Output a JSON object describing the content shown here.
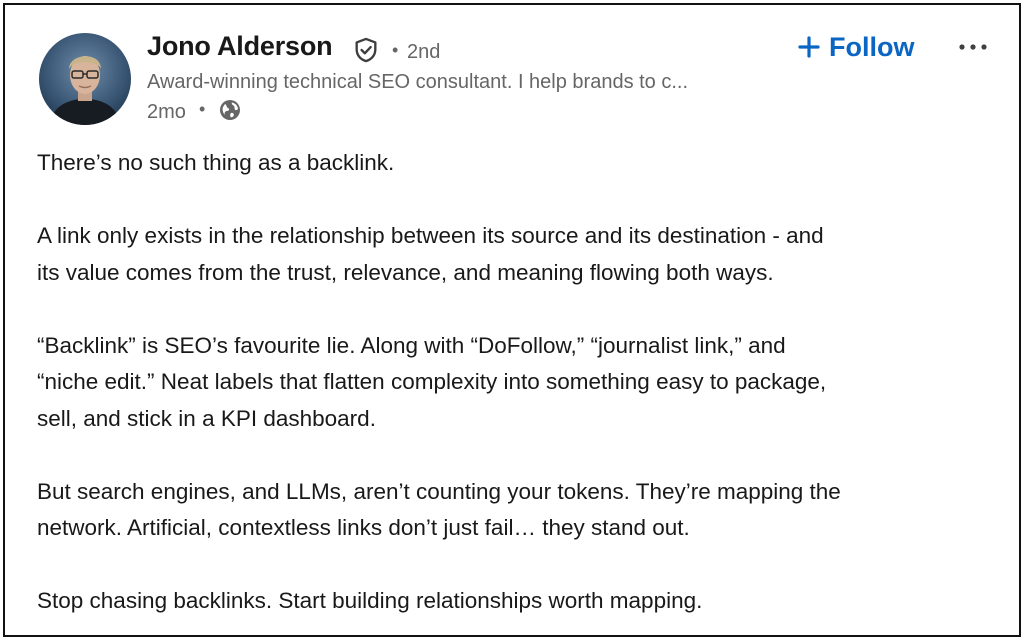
{
  "author": {
    "name": "Jono Alderson",
    "verified_icon": "verified-shield-icon",
    "degree": "2nd",
    "headline": "Award-winning technical SEO consultant. I help brands to c...",
    "timestamp": "2mo",
    "visibility_icon": "globe-icon"
  },
  "actions": {
    "follow_label": "Follow",
    "follow_icon": "plus-icon",
    "more_icon": "more-options-icon"
  },
  "colors": {
    "accent": "#0a66c2",
    "text_primary": "#191919",
    "text_secondary": "#666666"
  },
  "post": {
    "paragraphs": [
      {
        "lines": [
          "There’s no such thing as a backlink."
        ]
      },
      {
        "lines": [
          "A link only exists in the relationship between its source and its destination - and",
          "its value comes from the trust, relevance, and meaning flowing both ways."
        ]
      },
      {
        "lines": [
          "“Backlink” is SEO’s favourite lie. Along with “DoFollow,” “journalist link,” and",
          "“niche edit.” Neat labels that flatten complexity into something easy to package,",
          "sell, and stick in a KPI dashboard."
        ]
      },
      {
        "lines": [
          "But search engines, and LLMs, aren’t counting your tokens. They’re mapping the",
          "network. Artificial, contextless links don’t just fail… they stand out."
        ]
      },
      {
        "lines": [
          "Stop chasing backlinks. Start building relationships worth mapping."
        ]
      }
    ]
  }
}
